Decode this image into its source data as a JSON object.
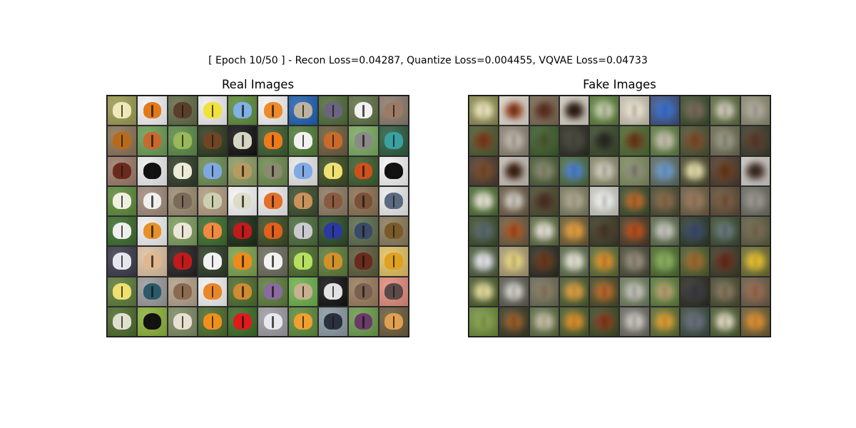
{
  "figure": {
    "suptitle": "[ Epoch 10/50 ] - Recon Loss=0.04287, Quantize Loss=0.004455, VQVAE Loss=0.04733",
    "panels": [
      {
        "title": "Real Images",
        "rows": 8,
        "cols": 10
      },
      {
        "title": "Fake Images",
        "rows": 8,
        "cols": 10
      }
    ]
  },
  "real_tiles": [
    {
      "bg": "#9a9a52",
      "wing": "#eee9b8"
    },
    {
      "bg": "#f2f2f2",
      "wing": "#e27a1c"
    },
    {
      "bg": "#5f6a45",
      "wing": "#5a3e2c"
    },
    {
      "bg": "#efefef",
      "wing": "#f0e23a"
    },
    {
      "bg": "#5c8a3a",
      "wing": "#7fb0e6"
    },
    {
      "bg": "#f3f3f3",
      "wing": "#ee8a2a"
    },
    {
      "bg": "#1e5fb0",
      "wing": "#bdb1a0"
    },
    {
      "bg": "#4d6a35",
      "wing": "#6a6480"
    },
    {
      "bg": "#5e7044",
      "wing": "#f1f1f1"
    },
    {
      "bg": "#8a7a6a",
      "wing": "#9c7a66"
    },
    {
      "bg": "#8a7255",
      "wing": "#b86a1c"
    },
    {
      "bg": "#6a9a52",
      "wing": "#c9682e"
    },
    {
      "bg": "#5a8a45",
      "wing": "#98b85a"
    },
    {
      "bg": "#2c3a1c",
      "wing": "#704424"
    },
    {
      "bg": "#111111",
      "wing": "#d6d6c4"
    },
    {
      "bg": "#3a5a2c",
      "wing": "#ee7a1c"
    },
    {
      "bg": "#4d7a35",
      "wing": "#f2f2f2"
    },
    {
      "bg": "#6a5a3a",
      "wing": "#c86a2a"
    },
    {
      "bg": "#7aa860",
      "wing": "#8a8a8a"
    },
    {
      "bg": "#2a5a40",
      "wing": "#3aa0a0"
    },
    {
      "bg": "#9a7a6a",
      "wing": "#6a2a1c"
    },
    {
      "bg": "#ececec",
      "wing": "#111111"
    },
    {
      "bg": "#2e3a25",
      "wing": "#ecead8"
    },
    {
      "bg": "#6a8a52",
      "wing": "#7fa8e2"
    },
    {
      "bg": "#8a9a60",
      "wing": "#b89a60"
    },
    {
      "bg": "#6a8a4a",
      "wing": "#8a8a70"
    },
    {
      "bg": "#e6e6e6",
      "wing": "#7faae6"
    },
    {
      "bg": "#3a4a20",
      "wing": "#f0e070"
    },
    {
      "bg": "#3a5a2a",
      "wing": "#d0501c"
    },
    {
      "bg": "#f2f2f2",
      "wing": "#111111"
    },
    {
      "bg": "#5a8a3a",
      "wing": "#f0f0e0"
    },
    {
      "bg": "#a08a7a",
      "wing": "#f0f0f0"
    },
    {
      "bg": "#9a8a70",
      "wing": "#7a6a5a"
    },
    {
      "bg": "#b09a80",
      "wing": "#cdd0b0"
    },
    {
      "bg": "#f4f4f4",
      "wing": "#dcdcc8"
    },
    {
      "bg": "#ececec",
      "wing": "#e2702a"
    },
    {
      "bg": "#3a4a2a",
      "wing": "#c8925a"
    },
    {
      "bg": "#8a7a60",
      "wing": "#8a5a40"
    },
    {
      "bg": "#8a7050",
      "wing": "#7a5038"
    },
    {
      "bg": "#eaeaea",
      "wing": "#5a6a80"
    },
    {
      "bg": "#3a6a2a",
      "wing": "#efefef"
    },
    {
      "bg": "#eeeeee",
      "wing": "#e6902a"
    },
    {
      "bg": "#7a9a5a",
      "wing": "#ece6d8"
    },
    {
      "bg": "#3a6a2a",
      "wing": "#f08a40"
    },
    {
      "bg": "#1a2a15",
      "wing": "#c01a1a"
    },
    {
      "bg": "#3a4a20",
      "wing": "#e0601c"
    },
    {
      "bg": "#4a6a3a",
      "wing": "#cacad0"
    },
    {
      "bg": "#2a4a25",
      "wing": "#2a3aa0"
    },
    {
      "bg": "#5a6a4a",
      "wing": "#3a4a6a"
    },
    {
      "bg": "#8a7a5a",
      "wing": "#7a5a2a"
    },
    {
      "bg": "#3a3a4a",
      "wing": "#e6e6f0"
    },
    {
      "bg": "#dcc0a0",
      "wing": "#e0b890"
    },
    {
      "bg": "#202020",
      "wing": "#c01a1a"
    },
    {
      "bg": "#2a3a25",
      "wing": "#f2f2f2"
    },
    {
      "bg": "#7aa04a",
      "wing": "#f08a1c"
    },
    {
      "bg": "#6a6a5a",
      "wing": "#f2f2f2"
    },
    {
      "bg": "#4a6a2a",
      "wing": "#b8e060"
    },
    {
      "bg": "#5a7a3a",
      "wing": "#d0902a"
    },
    {
      "bg": "#5a5a3a",
      "wing": "#6a2a1c"
    },
    {
      "bg": "#e0c060",
      "wing": "#e0a020"
    },
    {
      "bg": "#5a7a3a",
      "wing": "#f0e070"
    },
    {
      "bg": "#9a9a9a",
      "wing": "#2a5a6a"
    },
    {
      "bg": "#b0a08a",
      "wing": "#8a6a50"
    },
    {
      "bg": "#f0f0f0",
      "wing": "#e8862a"
    },
    {
      "bg": "#4a6a2a",
      "wing": "#d08a30"
    },
    {
      "bg": "#5a7a3a",
      "wing": "#8a6aa0"
    },
    {
      "bg": "#6ab04a",
      "wing": "#c8b090"
    },
    {
      "bg": "#111111",
      "wing": "#e2e2e2"
    },
    {
      "bg": "#9a7a5a",
      "wing": "#7a6050"
    },
    {
      "bg": "#e08a7a",
      "wing": "#5a4a4a"
    },
    {
      "bg": "#4a6a2a",
      "wing": "#e0e0d0"
    },
    {
      "bg": "#8ab03a",
      "wing": "#111111"
    },
    {
      "bg": "#7a8a60",
      "wing": "#e8e0d0"
    },
    {
      "bg": "#4a6a2a",
      "wing": "#f0901c"
    },
    {
      "bg": "#3a6a25",
      "wing": "#e01a1a"
    },
    {
      "bg": "#9a9aa0",
      "wing": "#e8e8f0"
    },
    {
      "bg": "#5a8a3a",
      "wing": "#f0a030"
    },
    {
      "bg": "#8a9aa0",
      "wing": "#2a3040"
    },
    {
      "bg": "#6a9a4a",
      "wing": "#6a3a6a"
    },
    {
      "bg": "#6a5a3a",
      "wing": "#e0a050"
    }
  ],
  "fake_tiles": [
    {
      "bg": "#8a8a50",
      "wing": "#efe6c0"
    },
    {
      "bg": "#dedad0",
      "wing": "#8a3a1c"
    },
    {
      "bg": "#7a6a55",
      "wing": "#5a3020"
    },
    {
      "bg": "#d8d4c8",
      "wing": "#2a1a10"
    },
    {
      "bg": "#5a7a3a",
      "wing": "#c8d0b0"
    },
    {
      "bg": "#c8c2b0",
      "wing": "#e8e0d0"
    },
    {
      "bg": "#3a5080",
      "wing": "#3a70d0"
    },
    {
      "bg": "#3a4a2a",
      "wing": "#7a6a5a"
    },
    {
      "bg": "#5a6a40",
      "wing": "#d6d0c0"
    },
    {
      "bg": "#8a8a70",
      "wing": "#b0aaa0"
    },
    {
      "bg": "#4a5a30",
      "wing": "#7a3a1c"
    },
    {
      "bg": "#8a8070",
      "wing": "#c0bab0"
    },
    {
      "bg": "#3a5a2a",
      "wing": "#4a5a30"
    },
    {
      "bg": "#2a2a20",
      "wing": "#4a4a40"
    },
    {
      "bg": "#3a4a2a",
      "wing": "#2a2a22"
    },
    {
      "bg": "#4a6a30",
      "wing": "#6a3a1c"
    },
    {
      "bg": "#5a7a40",
      "wing": "#c8c2b0"
    },
    {
      "bg": "#4a5030",
      "wing": "#7a4a2a"
    },
    {
      "bg": "#6a6a50",
      "wing": "#9a9a8a"
    },
    {
      "bg": "#3a3a2a",
      "wing": "#5a3a2a"
    },
    {
      "bg": "#4a3a2a",
      "wing": "#7a4a2a"
    },
    {
      "bg": "#c8c2b8",
      "wing": "#3a2010"
    },
    {
      "bg": "#4a5a35",
      "wing": "#8a8a70"
    },
    {
      "bg": "#4a6a40",
      "wing": "#4a80d0"
    },
    {
      "bg": "#8a8a6a",
      "wing": "#d0ccc0"
    },
    {
      "bg": "#7a8a5a",
      "wing": "#8a8a7a"
    },
    {
      "bg": "#5a6a60",
      "wing": "#6a9ad0"
    },
    {
      "bg": "#4a4a2a",
      "wing": "#e8e0b0"
    },
    {
      "bg": "#4a3a2a",
      "wing": "#6a3a1c"
    },
    {
      "bg": "#d0ccc8",
      "wing": "#3a2a20"
    },
    {
      "bg": "#4a6a30",
      "wing": "#eae6d8"
    },
    {
      "bg": "#6a5a45",
      "wing": "#d6d2c8"
    },
    {
      "bg": "#4a4a30",
      "wing": "#4a3020"
    },
    {
      "bg": "#7a7a60",
      "wing": "#b0a890"
    },
    {
      "bg": "#c8c8c0",
      "wing": "#ececec"
    },
    {
      "bg": "#3a4a2a",
      "wing": "#c06a2a"
    },
    {
      "bg": "#4a4a30",
      "wing": "#8a6a4a"
    },
    {
      "bg": "#6a5a40",
      "wing": "#9a7a60"
    },
    {
      "bg": "#5a4a35",
      "wing": "#7a5a40"
    },
    {
      "bg": "#6a6a60",
      "wing": "#9a9890"
    },
    {
      "bg": "#3a4a2a",
      "wing": "#5a6a70"
    },
    {
      "bg": "#6a5a40",
      "wing": "#b0501c"
    },
    {
      "bg": "#5a6a40",
      "wing": "#e8e2d8"
    },
    {
      "bg": "#6a5a30",
      "wing": "#e8a040"
    },
    {
      "bg": "#3a3a25",
      "wing": "#4a3a2a"
    },
    {
      "bg": "#4a3a25",
      "wing": "#c0501c"
    },
    {
      "bg": "#5a6a4a",
      "wing": "#c8c8c0"
    },
    {
      "bg": "#2a3a2a",
      "wing": "#3a4a6a"
    },
    {
      "bg": "#3a4a30",
      "wing": "#6a7a80"
    },
    {
      "bg": "#5a5a40",
      "wing": "#7a6a50"
    },
    {
      "bg": "#4a5a3a",
      "wing": "#e8e8f0"
    },
    {
      "bg": "#a89a70",
      "wing": "#e8d880"
    },
    {
      "bg": "#2a2a20",
      "wing": "#6a3a1c"
    },
    {
      "bg": "#5a6a4a",
      "wing": "#e8e4d8"
    },
    {
      "bg": "#5a6a35",
      "wing": "#e0902a"
    },
    {
      "bg": "#4a4a35",
      "wing": "#9a9080"
    },
    {
      "bg": "#4a6a2a",
      "wing": "#8ab060"
    },
    {
      "bg": "#4a5a2a",
      "wing": "#a06a30"
    },
    {
      "bg": "#3a3a25",
      "wing": "#6a2a1c"
    },
    {
      "bg": "#6a6a30",
      "wing": "#e8c030"
    },
    {
      "bg": "#4a5a2a",
      "wing": "#e8e0a0"
    },
    {
      "bg": "#5a5a50",
      "wing": "#dcdad4"
    },
    {
      "bg": "#6a6a55",
      "wing": "#8a7a60"
    },
    {
      "bg": "#4a5a30",
      "wing": "#e0a040"
    },
    {
      "bg": "#4a4a25",
      "wing": "#c06a2a"
    },
    {
      "bg": "#6a7a5a",
      "wing": "#c8c6c0"
    },
    {
      "bg": "#5a7a3a",
      "wing": "#b8a070"
    },
    {
      "bg": "#2a2a22",
      "wing": "#3a3a40"
    },
    {
      "bg": "#4a4a30",
      "wing": "#8a7a60"
    },
    {
      "bg": "#6a5a45",
      "wing": "#9a6a50"
    },
    {
      "bg": "#6a8a3a",
      "wing": "#8aa050"
    },
    {
      "bg": "#3a3a25",
      "wing": "#a0602a"
    },
    {
      "bg": "#5a6a40",
      "wing": "#c8c0a8"
    },
    {
      "bg": "#4a5a2a",
      "wing": "#e0902a"
    },
    {
      "bg": "#3a4a25",
      "wing": "#8a3a1c"
    },
    {
      "bg": "#6a6a60",
      "wing": "#d0ccc8"
    },
    {
      "bg": "#5a6a30",
      "wing": "#e0a030"
    },
    {
      "bg": "#3a4a40",
      "wing": "#6a7080"
    },
    {
      "bg": "#4a5a30",
      "wing": "#e8e0c8"
    },
    {
      "bg": "#6a5a30",
      "wing": "#e09030"
    }
  ]
}
